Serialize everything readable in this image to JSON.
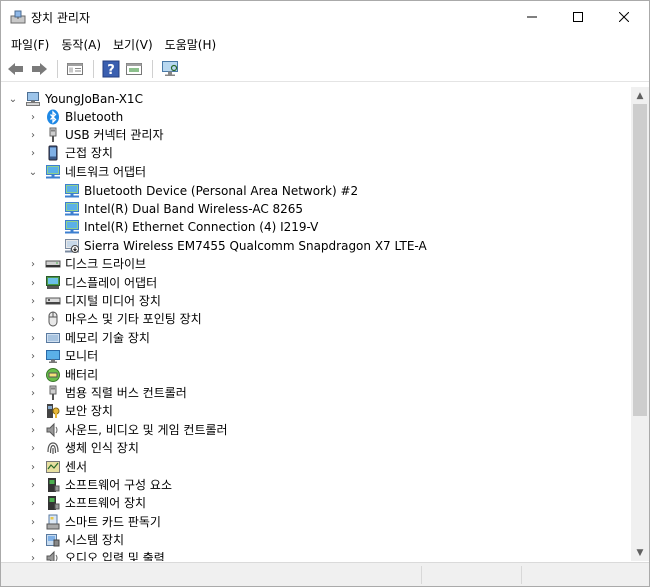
{
  "window": {
    "title": "장치 관리자"
  },
  "menu": [
    "파일(F)",
    "동작(A)",
    "보기(V)",
    "도움말(H)"
  ],
  "toolbar": {
    "buttons": [
      "back-icon",
      "forward-icon",
      "properties-icon",
      "help-icon",
      "update-driver-icon",
      "scan-hardware-icon"
    ]
  },
  "tree": {
    "root": "YoungJoBan-X1C",
    "items": [
      {
        "label": "Bluetooth",
        "icon": "bluetooth-icon",
        "expanded": false
      },
      {
        "label": "USB 커넥터 관리자",
        "icon": "usb-icon",
        "expanded": false
      },
      {
        "label": "근접 장치",
        "icon": "proximity-icon",
        "expanded": false
      },
      {
        "label": "네트워크 어댑터",
        "icon": "network-adapter-icon",
        "expanded": true,
        "children": [
          {
            "label": "Bluetooth Device (Personal Area Network) #2",
            "icon": "network-adapter-icon"
          },
          {
            "label": "Intel(R) Dual Band Wireless-AC 8265",
            "icon": "network-adapter-icon"
          },
          {
            "label": "Intel(R) Ethernet Connection (4) I219-V",
            "icon": "network-adapter-icon"
          },
          {
            "label": "Sierra Wireless EM7455 Qualcomm Snapdragon X7 LTE-A",
            "icon": "network-adapter-disabled-icon"
          }
        ]
      },
      {
        "label": "디스크 드라이브",
        "icon": "disk-drive-icon",
        "expanded": false
      },
      {
        "label": "디스플레이 어댑터",
        "icon": "display-adapter-icon",
        "expanded": false
      },
      {
        "label": "디지털 미디어 장치",
        "icon": "digital-media-icon",
        "expanded": false
      },
      {
        "label": "마우스 및 기타 포인팅 장치",
        "icon": "mouse-icon",
        "expanded": false
      },
      {
        "label": "메모리 기술 장치",
        "icon": "memory-icon",
        "expanded": false
      },
      {
        "label": "모니터",
        "icon": "monitor-icon",
        "expanded": false
      },
      {
        "label": "배터리",
        "icon": "battery-icon",
        "expanded": false
      },
      {
        "label": "범용 직렬 버스 컨트롤러",
        "icon": "usb-controller-icon",
        "expanded": false
      },
      {
        "label": "보안 장치",
        "icon": "security-icon",
        "expanded": false
      },
      {
        "label": "사운드, 비디오 및 게임 컨트롤러",
        "icon": "sound-icon",
        "expanded": false
      },
      {
        "label": "생체 인식 장치",
        "icon": "biometric-icon",
        "expanded": false
      },
      {
        "label": "센서",
        "icon": "sensor-icon",
        "expanded": false
      },
      {
        "label": "소프트웨어 구성 요소",
        "icon": "software-component-icon",
        "expanded": false
      },
      {
        "label": "소프트웨어 장치",
        "icon": "software-device-icon",
        "expanded": false
      },
      {
        "label": "스마트 카드 판독기",
        "icon": "smart-card-icon",
        "expanded": false
      },
      {
        "label": "시스템 장치",
        "icon": "system-device-icon",
        "expanded": false
      },
      {
        "label": "오디오 입력 및 출력",
        "icon": "audio-io-icon",
        "expanded": false
      }
    ]
  },
  "colors": {
    "network_green": "#4aa84a",
    "network_blue": "#3c7fd0",
    "bluetooth_blue": "#1e88e5"
  }
}
